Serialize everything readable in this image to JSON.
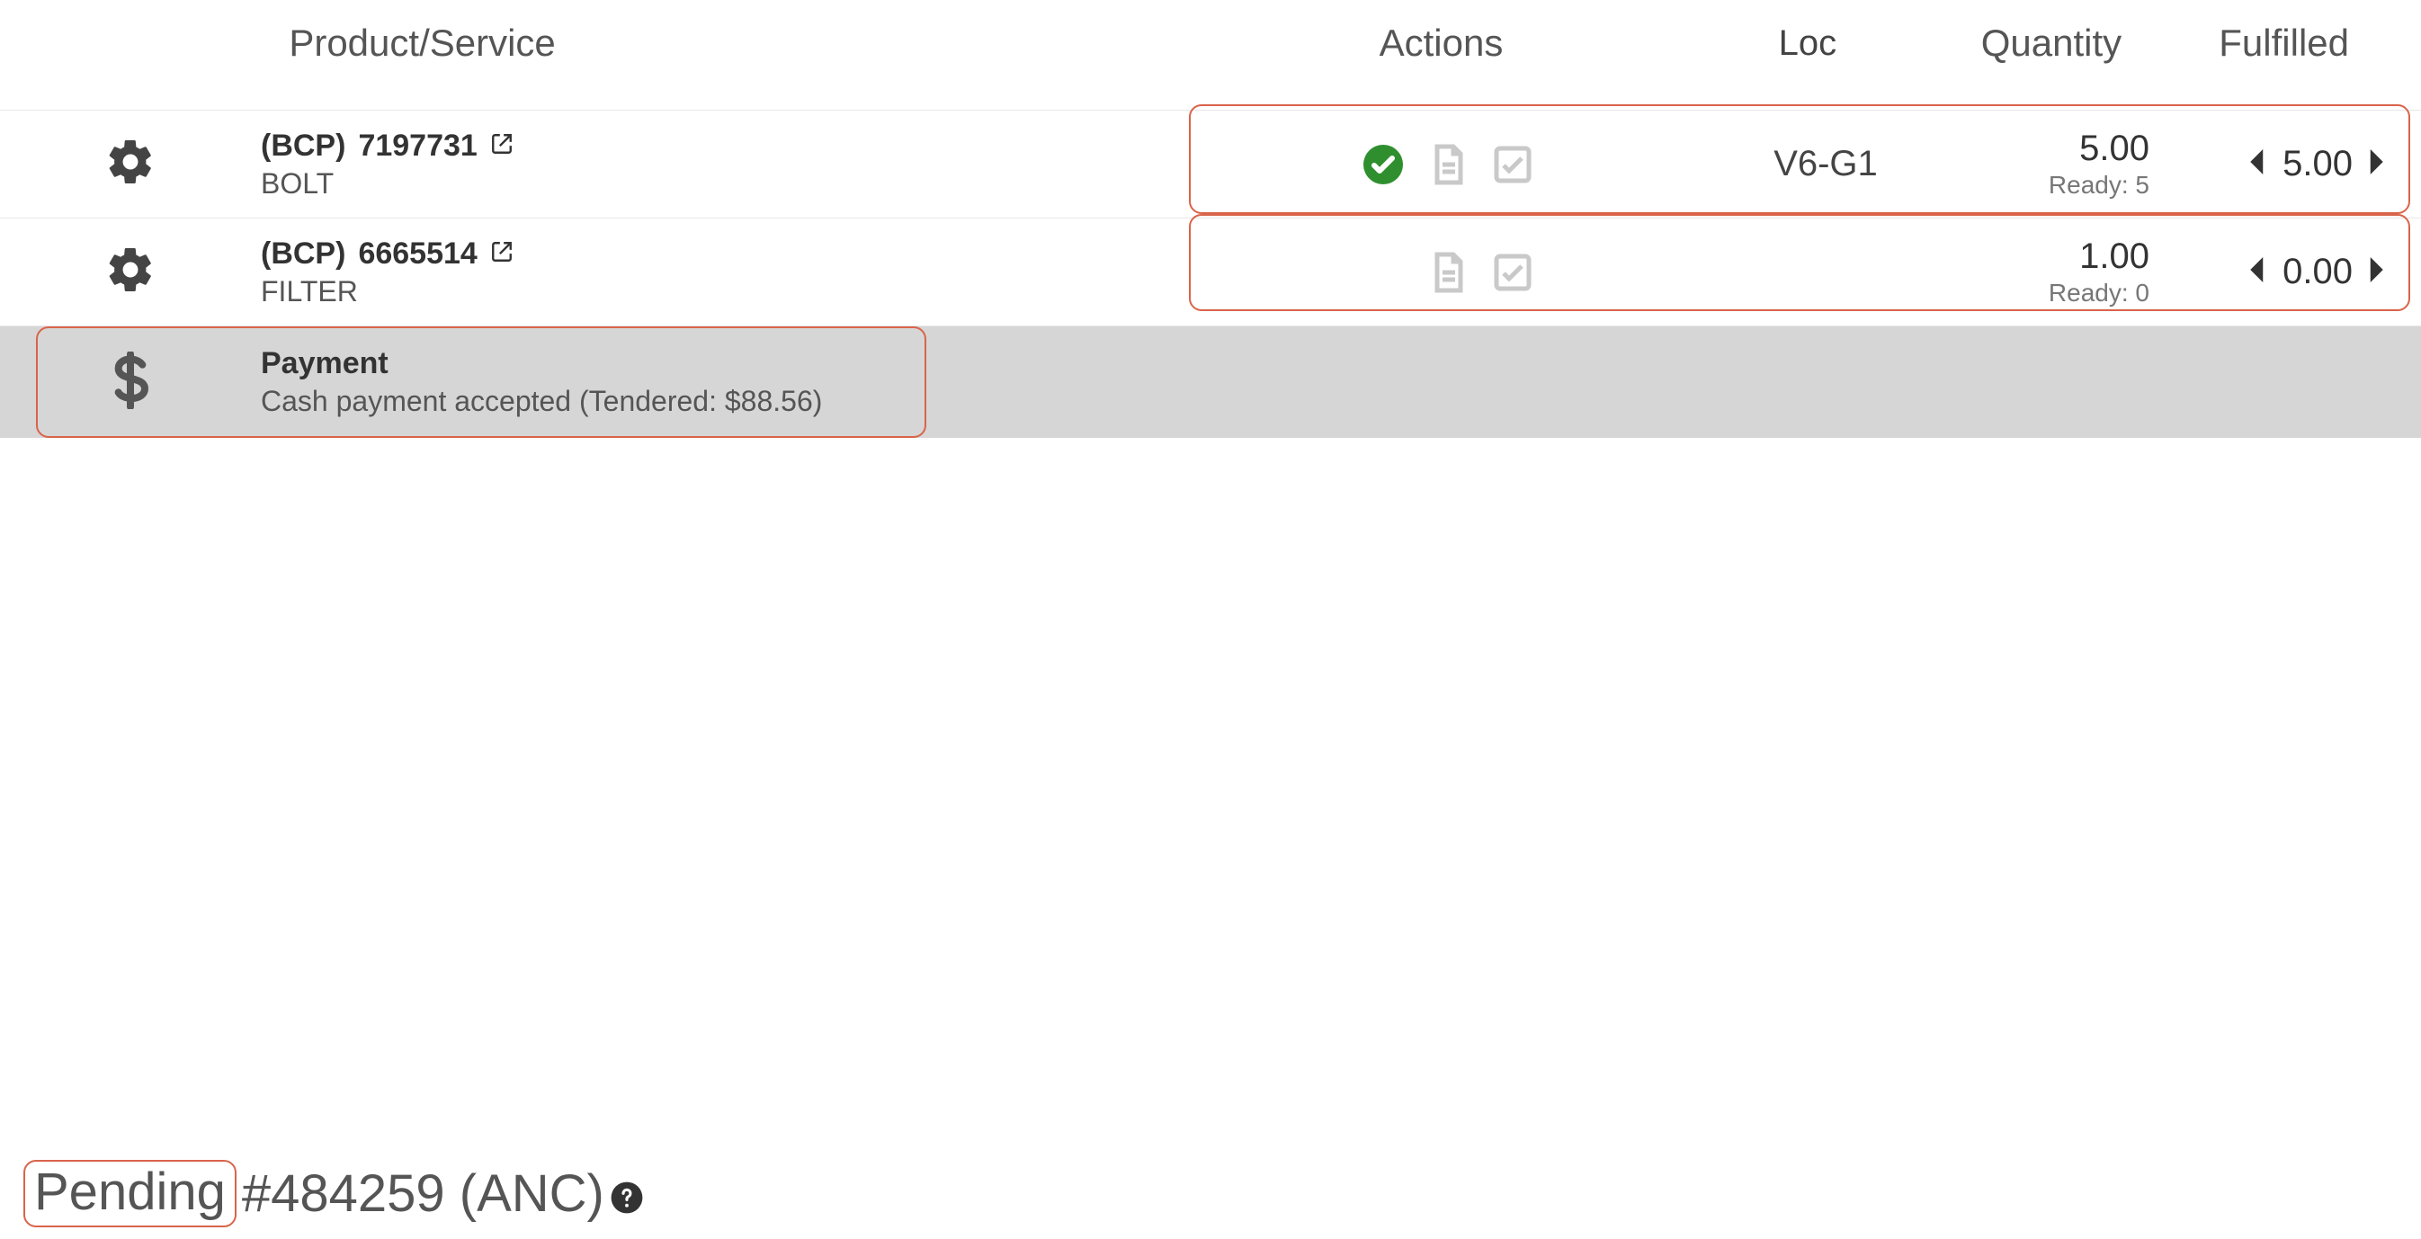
{
  "headers": {
    "product": "Product/Service",
    "actions": "Actions",
    "loc": "Loc",
    "quantity": "Quantity",
    "fulfilled": "Fulfilled"
  },
  "lines": [
    {
      "vendor": "(BCP)",
      "sku": "7197731",
      "name": "BOLT",
      "loc": "V6-G1",
      "qty": "5.00",
      "ready": "Ready: 5",
      "fulfilled": "5.00",
      "show_ok": true
    },
    {
      "vendor": "(BCP)",
      "sku": "6665514",
      "name": "FILTER",
      "loc": "",
      "qty": "1.00",
      "ready": "Ready: 0",
      "fulfilled": "0.00",
      "show_ok": false
    }
  ],
  "payment": {
    "title": "Payment",
    "detail": "Cash payment accepted (Tendered: $88.56)"
  },
  "footer": {
    "status": "Pending",
    "rest": "#484259 (ANC)"
  }
}
